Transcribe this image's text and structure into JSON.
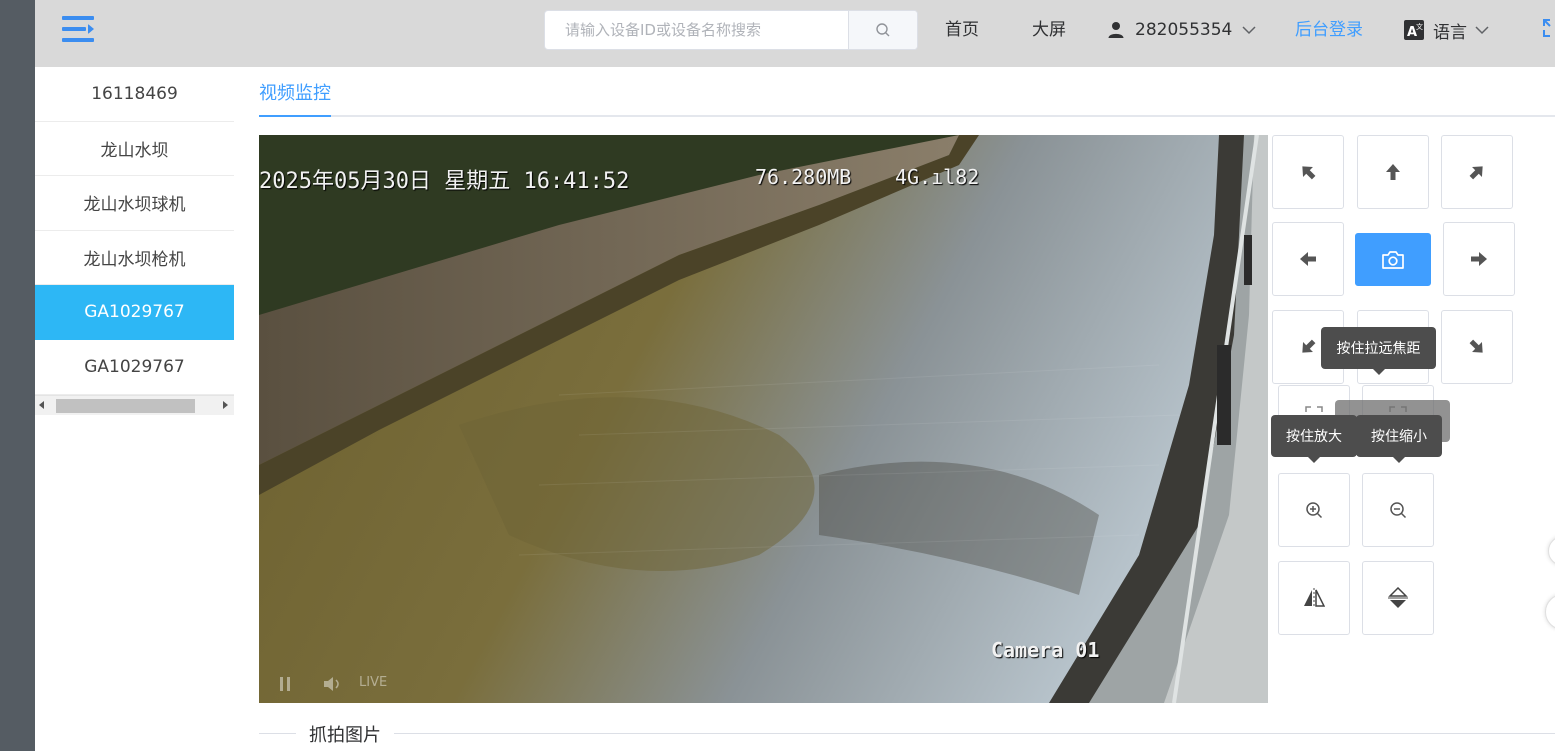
{
  "header": {
    "search_placeholder": "请输入设备ID或设备名称搜索",
    "nav": {
      "home": "首页",
      "big_screen": "大屏",
      "user_id": "282055354",
      "admin_login": "后台登录",
      "language": "语言"
    },
    "accent_color": "#409eff"
  },
  "sidebar": {
    "devices": [
      {
        "label": "16118469"
      },
      {
        "label": "龙山水坝"
      },
      {
        "label": "龙山水坝球机"
      },
      {
        "label": "龙山水坝枪机"
      },
      {
        "label": "GA1029767",
        "active": true
      },
      {
        "label": "GA1029767"
      }
    ],
    "active_color": "#2db7f5"
  },
  "tabs": {
    "video_monitor": "视频监控"
  },
  "video": {
    "timestamp": "2025年05月30日 星期五 16:41:52",
    "bitrate": "76.280MB",
    "signal": "4G.ıl82",
    "camera_name": "Camera 01",
    "live_label": "LIVE"
  },
  "ptz": {
    "tooltip_focus": "按住拉远焦距",
    "tooltip_zoom_in": "按住放大",
    "tooltip_zoom_out": "按住缩小",
    "icons": [
      "arrow-up-left-icon",
      "arrow-up-icon",
      "arrow-up-right-icon",
      "arrow-left-icon",
      "camera-icon",
      "arrow-right-icon",
      "arrow-down-left-icon",
      "arrow-down-icon",
      "arrow-down-right-icon",
      "focus-near-icon",
      "focus-far-icon",
      "zoom-in-icon",
      "zoom-out-icon",
      "flip-horizontal-icon",
      "flip-vertical-icon"
    ]
  },
  "snapshot_section": {
    "title": "抓拍图片"
  }
}
